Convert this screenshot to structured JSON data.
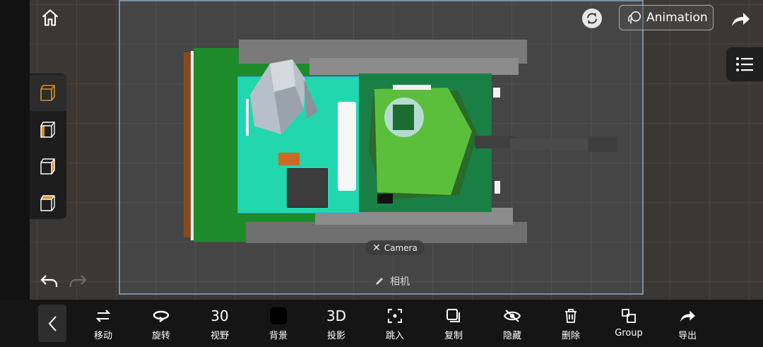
{
  "animation": {
    "label": "Animation"
  },
  "camera_tag": {
    "label": "Camera"
  },
  "camera_label": {
    "text": "相机"
  },
  "toolbar": [
    {
      "id": "move",
      "glyph": "",
      "label": "移动"
    },
    {
      "id": "rotate",
      "glyph": "",
      "label": "旋转"
    },
    {
      "id": "fov",
      "glyph": "30",
      "label": "视野"
    },
    {
      "id": "background",
      "glyph": "",
      "label": "背景"
    },
    {
      "id": "projection",
      "glyph": "3D",
      "label": "投影"
    },
    {
      "id": "jump-in",
      "glyph": "",
      "label": "跳入"
    },
    {
      "id": "copy",
      "glyph": "",
      "label": "复制"
    },
    {
      "id": "hide",
      "glyph": "",
      "label": "隐藏"
    },
    {
      "id": "delete",
      "glyph": "",
      "label": "删除"
    },
    {
      "id": "group",
      "glyph": "",
      "label": "Group"
    },
    {
      "id": "export",
      "glyph": "",
      "label": "导出"
    }
  ],
  "colors": {
    "accent_orange": "#d6902a",
    "hull_green": "#1f8a2a",
    "turret_green": "#5cbf3c",
    "cyan_floor": "#22d6ae"
  }
}
